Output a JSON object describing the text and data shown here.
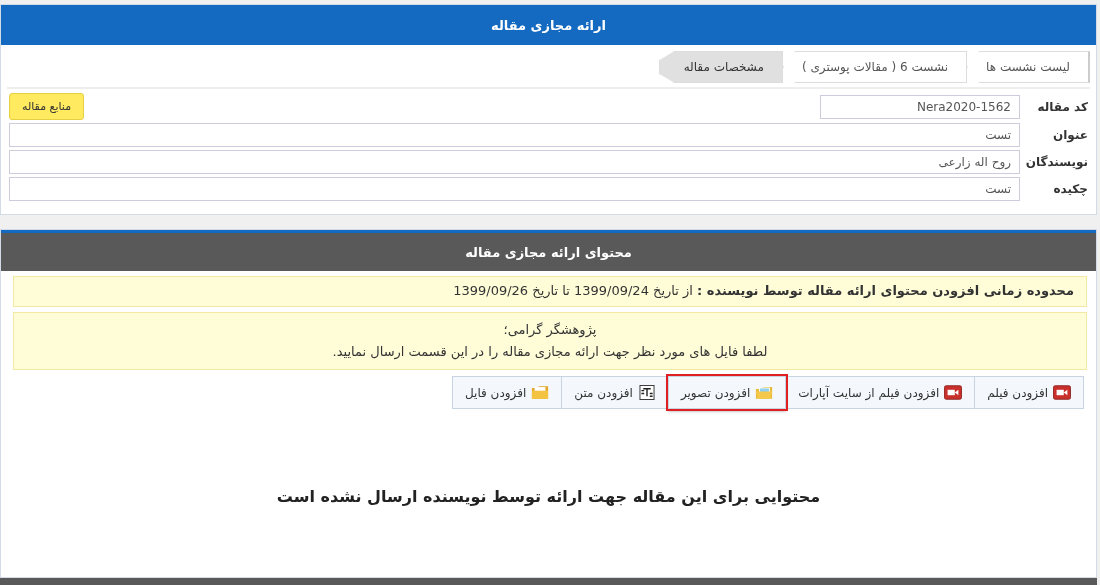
{
  "header": {
    "title": "ارائه مجازی مقاله"
  },
  "breadcrumb": [
    {
      "label": "لیست نشست ها",
      "selected": false
    },
    {
      "label": "نشست 6 ( مقالات پوستری )",
      "selected": false
    },
    {
      "label": "مشخصات مقاله",
      "selected": true
    }
  ],
  "sources_button": {
    "label": "منابع مقاله"
  },
  "fields": [
    {
      "kind": "short",
      "label": "کد مقاله",
      "value": "Nera2020-1562"
    },
    {
      "kind": "wide",
      "label": "عنوان",
      "value": "تست"
    },
    {
      "kind": "wide",
      "label": "نویسندگان",
      "value": "روح اله زارعی"
    },
    {
      "kind": "wide",
      "label": "چکیده",
      "value": "تست"
    }
  ],
  "content_panel": {
    "title": "محتوای ارائه مجازی مقاله",
    "date_notice": "**محدوده زمانی افزودن محتوای ارائه مقاله توسط نویسنده :** از تاریخ 1399/09/24 تا تاریخ 1399/09/26",
    "notice_lines": [
      "پژوهشگر گرامی؛",
      "لطفا فایل های مورد نظر جهت ارائه مجازی مقاله را در این قسمت ارسال نمایید."
    ],
    "buttons": [
      {
        "kind": "video",
        "label": "افزودن فیلم",
        "highlighted": false
      },
      {
        "kind": "video",
        "label": "افزودن فیلم از سایت آپارات",
        "highlighted": false
      },
      {
        "kind": "image",
        "label": "افزودن تصویر",
        "highlighted": true
      },
      {
        "kind": "text",
        "label": "افزودن متن",
        "highlighted": false
      },
      {
        "kind": "file",
        "label": "افزودن فایل",
        "highlighted": false
      }
    ],
    "empty_message": "محتوایی برای این مقاله جهت ارائه توسط نویسنده ارسال نشده است"
  }
}
